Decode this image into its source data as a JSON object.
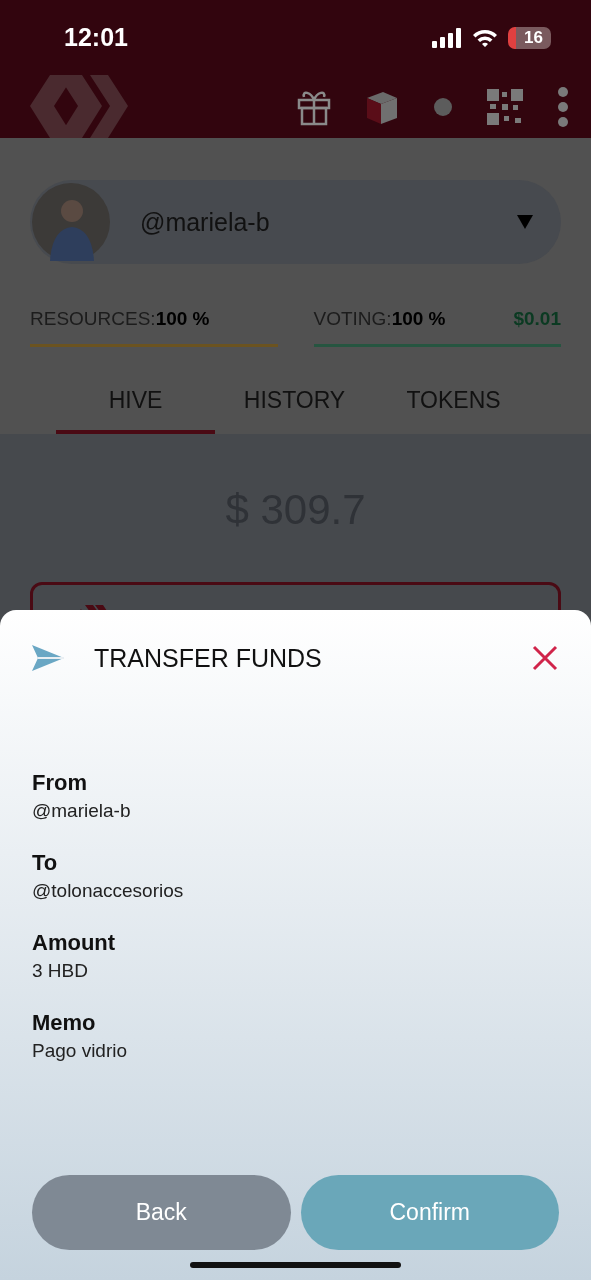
{
  "status_bar": {
    "time": "12:01",
    "battery": "16"
  },
  "account": {
    "name": "@mariela-b"
  },
  "meters": [
    {
      "label": "RESOURCES:",
      "value": "100 %",
      "level": 1,
      "color": "#6b5320"
    },
    {
      "label": "VOTING:",
      "value": "100 %",
      "level": 1,
      "color": "#265540",
      "reward": "$0.01"
    }
  ],
  "tabs": [
    {
      "label": "HIVE",
      "selected": true
    },
    {
      "label": "HISTORY",
      "selected": false
    },
    {
      "label": "TOKENS",
      "selected": false
    }
  ],
  "balance": "$ 309.7",
  "sheet": {
    "title": "TRANSFER FUNDS",
    "fields": [
      {
        "label": "From",
        "value": "@mariela-b"
      },
      {
        "label": "To",
        "value": "@tolonaccesorios"
      },
      {
        "label": "Amount",
        "value": "3 HBD"
      },
      {
        "label": "Memo",
        "value": "Pago vidrio"
      }
    ],
    "buttons": [
      {
        "label": "Back",
        "kind": "secondary"
      },
      {
        "label": "Confirm",
        "kind": "primary"
      }
    ]
  }
}
